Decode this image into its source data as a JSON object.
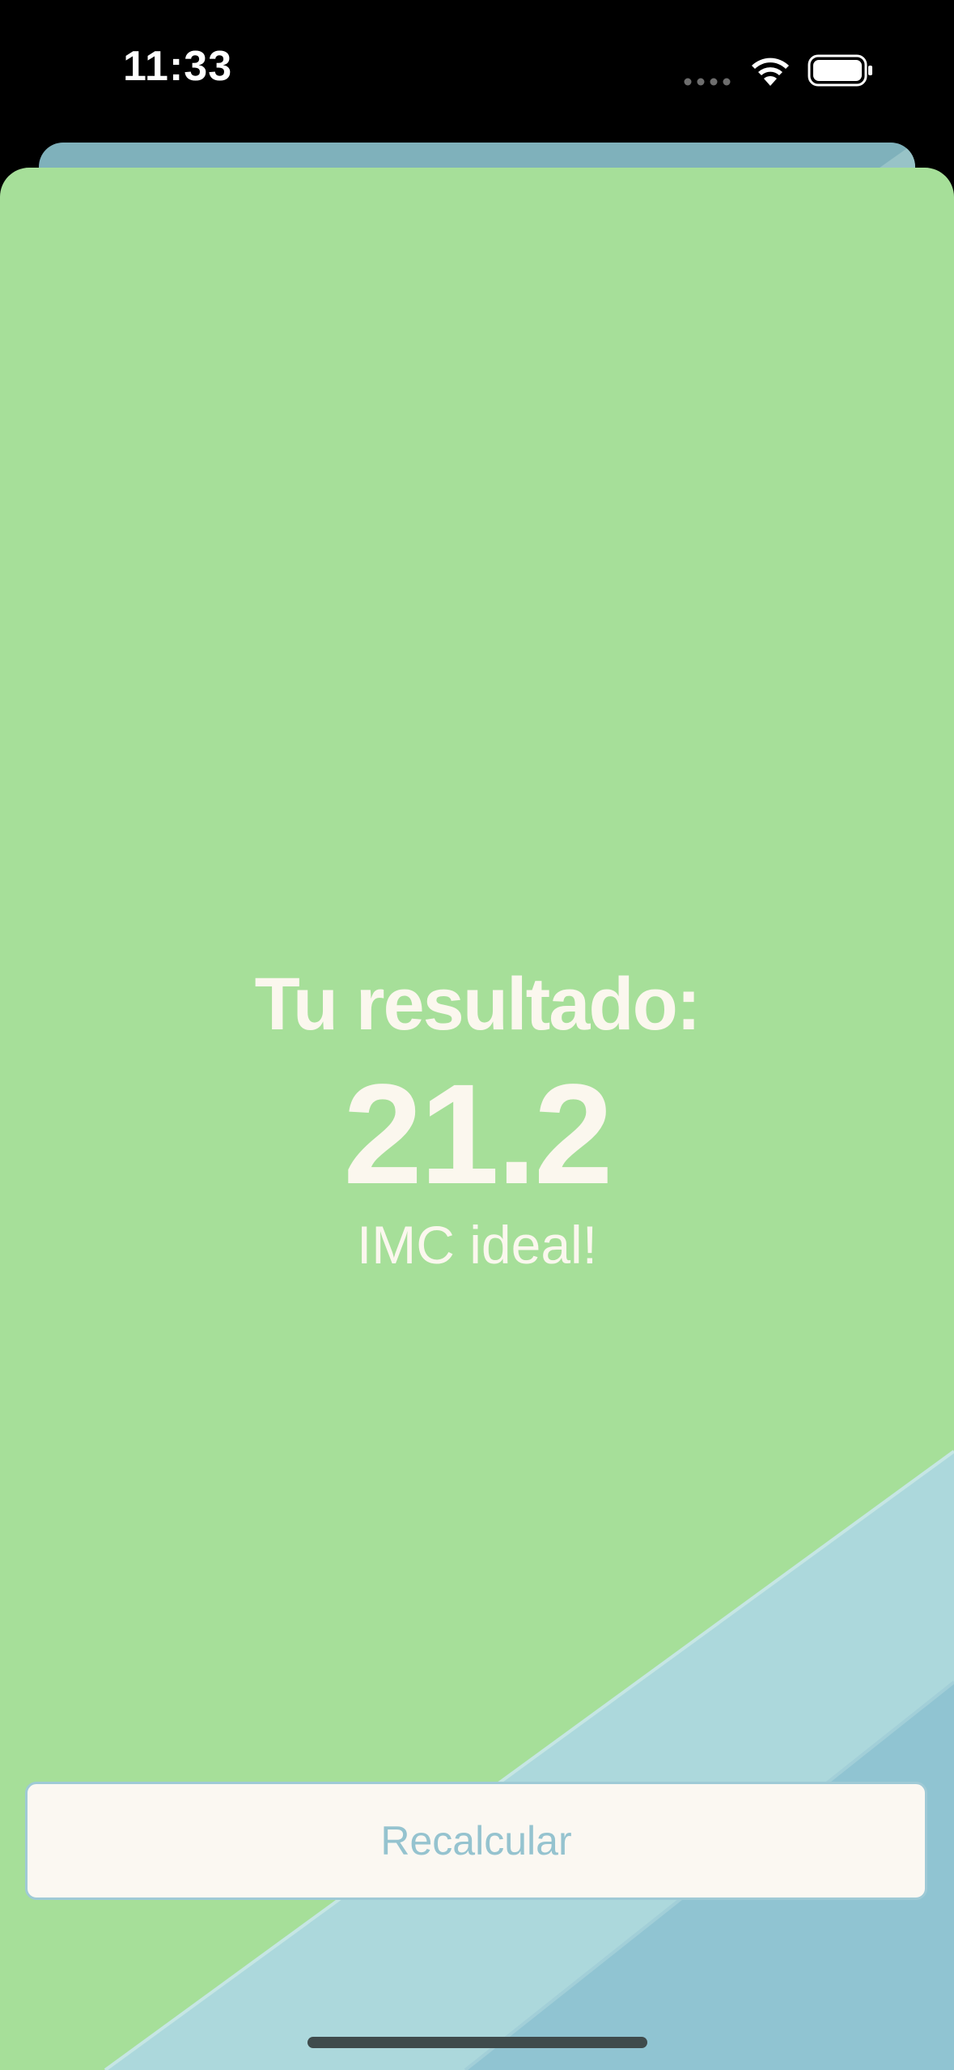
{
  "status_bar": {
    "time": "11:33",
    "icons": [
      "cellular-dots-icon",
      "wifi-icon",
      "battery-icon"
    ]
  },
  "result": {
    "title": "Tu resultado:",
    "value": "21.2",
    "label": "IMC ideal!"
  },
  "actions": {
    "recalculate_label": "Recalcular"
  },
  "colors": {
    "sheet_background": "#a6df99",
    "text_light": "#fbf7ee",
    "button_background": "#fbf8f2",
    "button_text": "#95c3cf",
    "decor_light_blue": "#acd8dc",
    "decor_mid_blue": "#90c4d2",
    "back_sheet": "#7fb1bb"
  }
}
